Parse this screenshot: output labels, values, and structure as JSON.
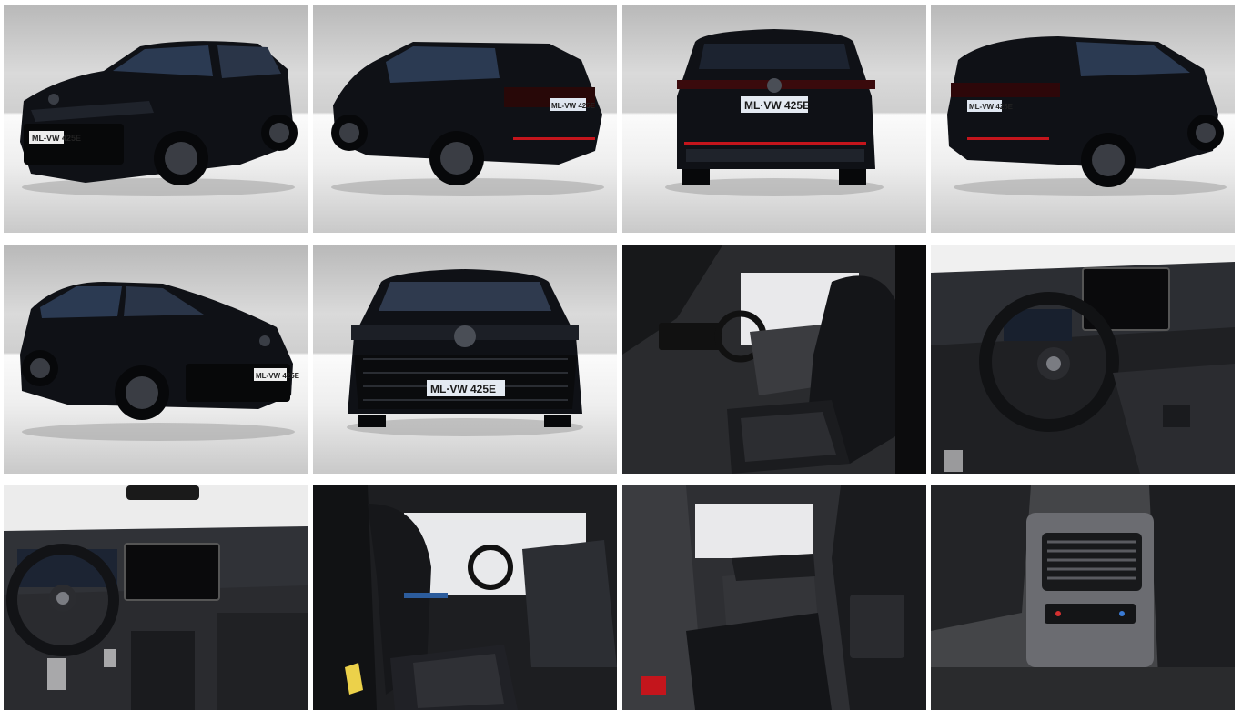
{
  "gallery": {
    "photos": [
      {
        "view": "front-left exterior",
        "plate": "ML-VW 425E"
      },
      {
        "view": "rear-left exterior",
        "plate": "ML-VW 425E"
      },
      {
        "view": "rear exterior",
        "plate": "ML·VW 425E"
      },
      {
        "view": "rear-right exterior",
        "plate": "ML-VW 425E"
      },
      {
        "view": "front-right exterior",
        "plate": "ML-VW 425E"
      },
      {
        "view": "front exterior",
        "plate": "ML·VW 425E"
      },
      {
        "view": "front seats interior",
        "plate": ""
      },
      {
        "view": "cockpit steering wheel",
        "plate": ""
      },
      {
        "view": "dashboard",
        "plate": ""
      },
      {
        "view": "front seat from door",
        "plate": ""
      },
      {
        "view": "rear seats interior",
        "plate": ""
      },
      {
        "view": "rear air vents",
        "plate": ""
      }
    ]
  },
  "colors": {
    "body": "#0f1116",
    "accent_red": "#c4151c",
    "studio_bg": "#d4d4d4"
  }
}
